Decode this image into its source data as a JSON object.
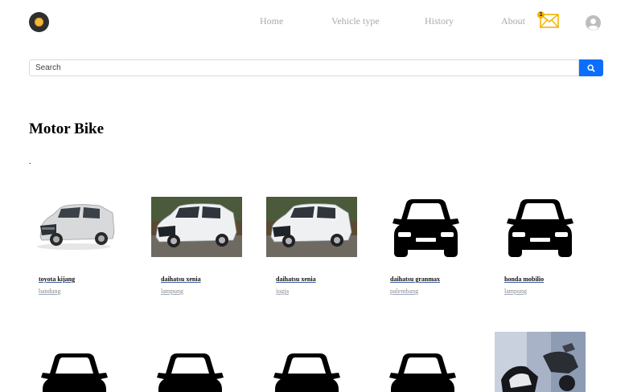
{
  "nav": {
    "links": [
      "Home",
      "Vehicle type",
      "History",
      "About"
    ],
    "notification_count": "1",
    "brand_color": "#f6b83a",
    "icons": [
      "logo-icon",
      "mail-icon",
      "user-avatar-icon"
    ]
  },
  "search": {
    "placeholder": "Search",
    "value": "",
    "button_color": "#0d6efd",
    "icon": "search-icon"
  },
  "page": {
    "title": "Motor Bike",
    "subtitle": "."
  },
  "cards": [
    {
      "name": "toyota kijang",
      "city": "bandung",
      "image": "car-photo-silver-suv"
    },
    {
      "name": "daihatsu xenia",
      "city": "lampung",
      "image": "car-photo-white-mpv"
    },
    {
      "name": "daihatsu xenia",
      "city": "jogja",
      "image": "car-photo-white-mpv"
    },
    {
      "name": "daihatsu granmax",
      "city": "palembang",
      "image": "car-silhouette-icon"
    },
    {
      "name": "honda mobilio",
      "city": "lampung",
      "image": "car-silhouette-icon"
    },
    {
      "name": "",
      "city": "",
      "image": "car-silhouette-icon"
    },
    {
      "name": "",
      "city": "",
      "image": "car-silhouette-icon"
    },
    {
      "name": "",
      "city": "",
      "image": "car-silhouette-icon"
    },
    {
      "name": "",
      "city": "",
      "image": "car-silhouette-icon"
    },
    {
      "name": "",
      "city": "",
      "image": "motorbike-photo"
    }
  ]
}
